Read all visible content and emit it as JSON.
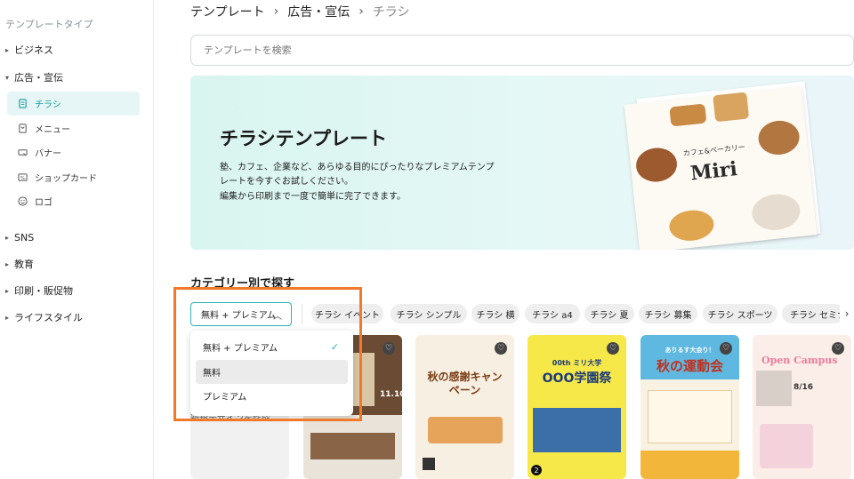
{
  "sidebar": {
    "title": "テンプレートタイプ",
    "items": [
      {
        "label": "ビジネス",
        "expanded": false
      },
      {
        "label": "広告・宣伝",
        "expanded": true
      },
      {
        "label": "SNS",
        "expanded": false
      },
      {
        "label": "教育",
        "expanded": false
      },
      {
        "label": "印刷・販促物",
        "expanded": false
      },
      {
        "label": "ライフスタイル",
        "expanded": false
      }
    ],
    "subitems": [
      {
        "label": "チラシ",
        "icon": "flyer-icon",
        "active": true
      },
      {
        "label": "メニュー",
        "icon": "menu-icon",
        "active": false
      },
      {
        "label": "バナー",
        "icon": "banner-icon",
        "active": false
      },
      {
        "label": "ショップカード",
        "icon": "shop-card-icon",
        "active": false
      },
      {
        "label": "ロゴ",
        "icon": "logo-icon",
        "active": false
      }
    ]
  },
  "breadcrumb": {
    "items": [
      "テンプレート",
      "広告・宣伝",
      "チラシ"
    ],
    "separator": "›"
  },
  "search": {
    "placeholder": "テンプレートを検索"
  },
  "banner": {
    "title": "チラシテンプレート",
    "lines": [
      "塾、カフェ、企業など、あらゆる目的にぴったりなプレミアムテンプ",
      "レートを今すぐお試しください。",
      "編集から印刷まで一度で簡単に完了できます。"
    ],
    "flyer_cafe": "カフェ&ベーカリー",
    "flyer_brand": "Miri"
  },
  "categories": {
    "title": "カテゴリー別で探す",
    "filter": {
      "selected": "無料 + プレミアム"
    },
    "chips": [
      "チラシ イベント",
      "チラシ シンプル",
      "チラシ 横",
      "チラシ a4",
      "チラシ 夏",
      "チラシ 募集",
      "チラシ スポーツ",
      "チラシ セミナー"
    ]
  },
  "dropdown": {
    "options": [
      {
        "label": "無料 + プレミアム",
        "selected": true
      },
      {
        "label": "無料",
        "selected": false,
        "hover": true
      },
      {
        "label": "プレミアム",
        "selected": false
      }
    ]
  },
  "new_design": {
    "label": "新規デザインを作成"
  },
  "cards": [
    {
      "title": "",
      "subtitle": "11.10",
      "bg": "#e9e3da"
    },
    {
      "title": "秋の感謝キャンペーン",
      "subtitle": "",
      "bg": "#f7efe2"
    },
    {
      "title": "OOO学園祭",
      "subtitle": "00th ミリ大学",
      "bg": "#f7e84a",
      "badge": "2"
    },
    {
      "title": "秋の運動会",
      "subtitle": "ありるす大会り！",
      "bg": "#f9f2e3"
    },
    {
      "title": "Open Campus",
      "subtitle": "8/16",
      "bg": "#fbeee8"
    }
  ],
  "colors": {
    "accent": "#2bb3b3",
    "highlight_box": "#f07a2a"
  }
}
